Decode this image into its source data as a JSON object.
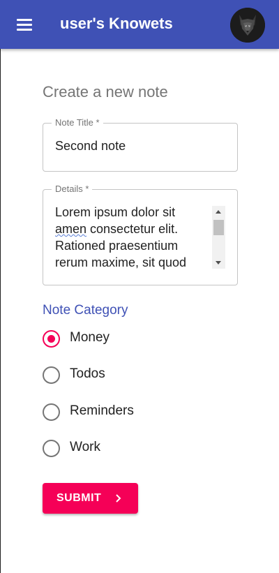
{
  "appbar": {
    "title": "user's Knowets",
    "color": "#3f51b5",
    "menu_icon": "menu-icon",
    "avatar_icon": "wolf-avatar"
  },
  "form": {
    "heading": "Create a new note",
    "title_field": {
      "label": "Note Title *",
      "value": "Second note"
    },
    "details_field": {
      "label": "Details *",
      "value_part1": "Lorem ipsum dolor sit ",
      "value_misspelled": "amen",
      "value_part2": " consectetur  elit. Rationed praesentium rerum maxime, sit quod"
    },
    "category": {
      "label": "Note Category",
      "options": [
        {
          "label": "Money",
          "checked": true
        },
        {
          "label": "Todos",
          "checked": false
        },
        {
          "label": "Reminders",
          "checked": false
        },
        {
          "label": "Work",
          "checked": false
        }
      ]
    },
    "submit_label": "SUBMIT",
    "submit_icon": "chevron-right-icon",
    "accent_color": "#f50057"
  }
}
